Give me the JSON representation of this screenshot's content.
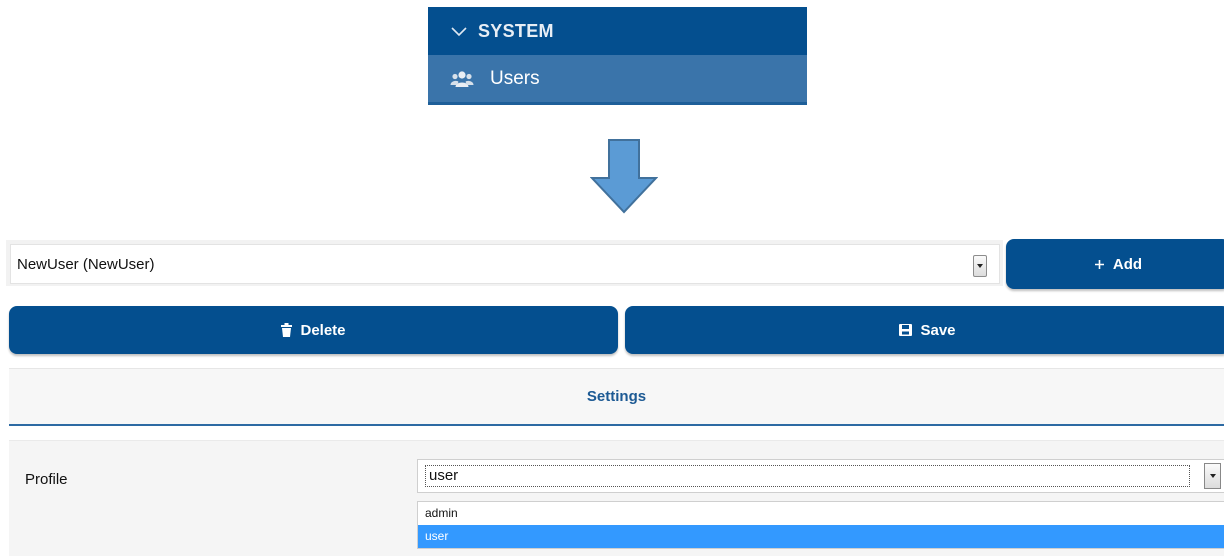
{
  "sidebar": {
    "section_title": "SYSTEM",
    "item_label": "Users",
    "icons": {
      "collapse": "chevron-down-icon",
      "item": "users-icon"
    }
  },
  "arrow": {
    "icon": "arrow-down-icon"
  },
  "panel": {
    "user_select": {
      "value": "NewUser (NewUser)"
    },
    "add_button": {
      "label": "Add",
      "icon": "plus-icon"
    },
    "delete_button": {
      "label": "Delete",
      "icon": "trash-icon"
    },
    "save_button": {
      "label": "Save",
      "icon": "floppy-disk-icon"
    },
    "settings_tab": {
      "label": "Settings"
    },
    "profile": {
      "label": "Profile",
      "value": "user",
      "options": [
        "admin",
        "user"
      ],
      "selected_index": 1
    }
  },
  "colors": {
    "primary": "#044f8f",
    "sidebar_item_bg": "#3a74aa",
    "arrow_fill": "#5b9bd5",
    "option_highlight": "#3399ff"
  }
}
